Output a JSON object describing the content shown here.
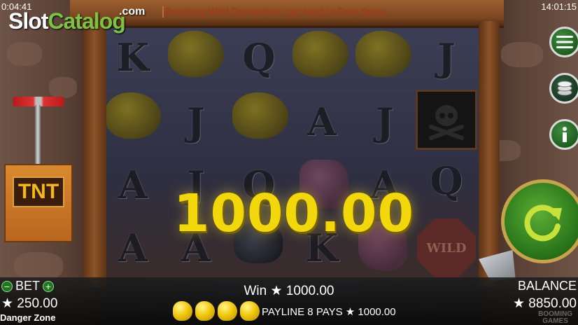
{
  "status_bar": {
    "time_left": "0:04:41",
    "time_right": "14:01:15"
  },
  "watermark": {
    "part1": "Slot",
    "part2": "Catalog",
    "suffix": ".com"
  },
  "ticker": {
    "message": "Bursting Wild Dynamites can land in Free Spins"
  },
  "tnt": {
    "label": "TNT"
  },
  "reels": {
    "symbols": [
      {
        "label": "K"
      },
      {
        "label": "Q"
      },
      {
        "label": "J"
      },
      {
        "label": "J"
      },
      {
        "label": "A"
      },
      {
        "label": "J"
      },
      {
        "label": "A"
      },
      {
        "label": "J"
      },
      {
        "label": "Q"
      },
      {
        "label": "A"
      },
      {
        "label": "Q"
      },
      {
        "label": "A"
      },
      {
        "label": "A"
      },
      {
        "label": "K"
      }
    ],
    "wild_label": "WILD"
  },
  "big_win": {
    "amount": "1000.00"
  },
  "controls": {
    "menu_icon": "hamburger-icon",
    "coins_icon": "coin-stack-icon",
    "info_icon": "info-icon",
    "spin_icon": "spin-arrow-icon"
  },
  "bottom_bar": {
    "bet_label": "BET",
    "bet_minus": "−",
    "bet_plus": "+",
    "bet_value": "★ 250.00",
    "game_name": "Danger Zone",
    "win_text": "Win ★ 1000.00",
    "payline_text": "PAYLINE 8 PAYS ★ 1000.00",
    "balance_label": "BALANCE",
    "balance_value": "★ 8850.00",
    "provider_line1": "BOOMING",
    "provider_line2": "GAMES"
  },
  "colors": {
    "accent_green": "#2c7a1c",
    "win_gold": "#f2d80a",
    "ticker_red": "#a13b1a"
  }
}
